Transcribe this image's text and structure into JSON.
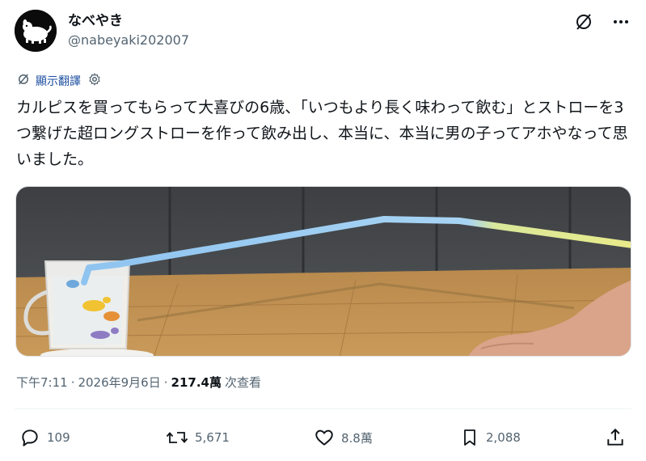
{
  "author": {
    "display_name": "なべやき",
    "handle": "@nabeyaki202007",
    "avatar_icon": "dog-avatar-icon"
  },
  "top_actions": {
    "grok_icon": "grok-icon",
    "more_icon": "more-icon"
  },
  "translate": {
    "label": "顯示翻譯",
    "icon": "translate-icon",
    "settings_icon": "gear-icon"
  },
  "tweet": {
    "text": "カルピスを買ってもらって大喜びの6歳、「いつもより長く味わって飲む」とストローを3つ繋げた超ロングストローを作って飲み出し、本当に、本当に男の子ってアホやなって思いました。"
  },
  "media": {
    "description_icon": "photo-straw-cup"
  },
  "meta": {
    "time": "下午7:11",
    "separator": "·",
    "date": "2026年9月6日",
    "separator2": "·",
    "views": "217.4萬",
    "views_label": "次查看"
  },
  "actions": {
    "reply_count": "109",
    "retweet_count": "5,671",
    "like_count": "8.8萬",
    "bookmark_count": "2,088"
  },
  "colors": {
    "text_primary": "#0f1419",
    "text_secondary": "#536471",
    "link_blue": "#1d4fa0"
  }
}
